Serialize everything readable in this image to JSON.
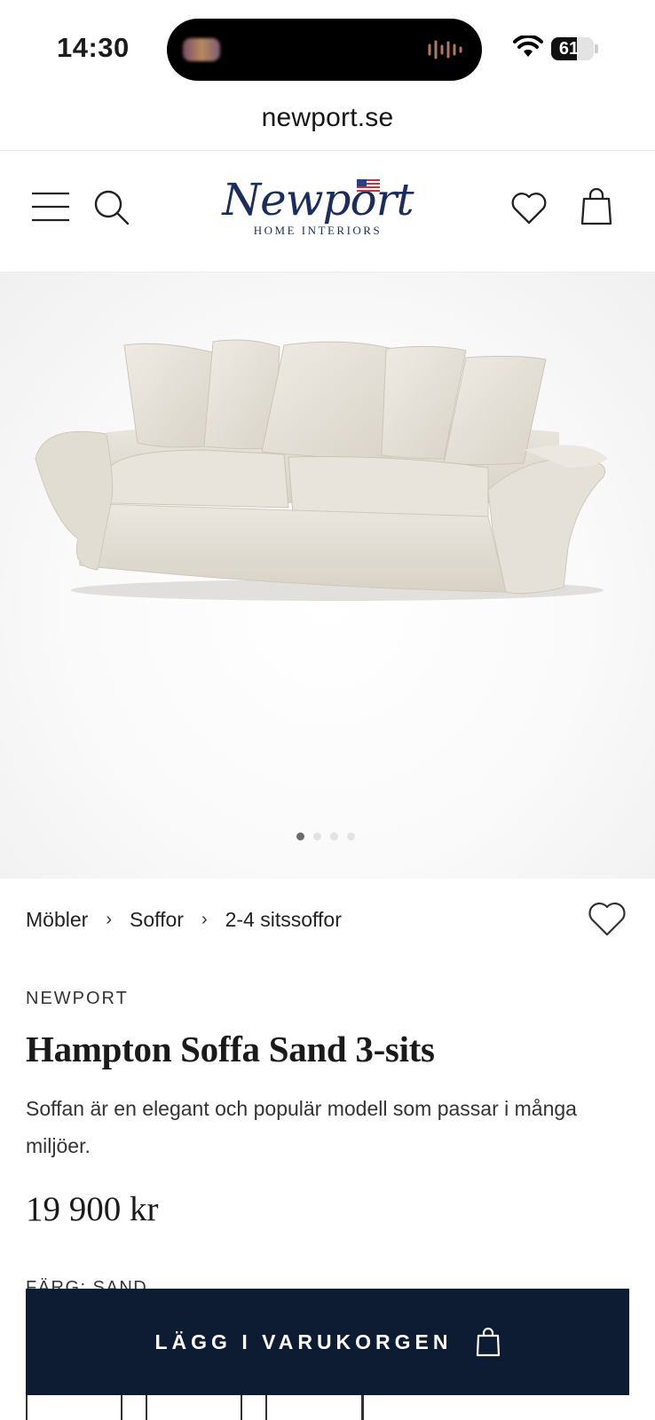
{
  "status_bar": {
    "time": "14:30",
    "battery": "61",
    "battery_level": 0.61
  },
  "browser": {
    "url": "newport.se"
  },
  "header": {
    "logo_word": "Newport",
    "logo_sub": "HOME INTERIORS",
    "icons": [
      "menu-icon",
      "search-icon",
      "wishlist-icon",
      "bag-icon"
    ]
  },
  "gallery": {
    "slides": 4,
    "active": 0
  },
  "breadcrumb": {
    "items": [
      "Möbler",
      "Soffor",
      "2-4 sitssoffor"
    ],
    "separator": "›"
  },
  "product": {
    "brand": "NEWPORT",
    "title": "Hampton Soffa Sand 3-sits",
    "description": "Soffan är en elegant och populär modell som passar i många miljöer.",
    "price": "19 900 kr",
    "color_label": "FÄRG: SAND"
  },
  "cta": {
    "label": "LÄGG I VARUKORGEN"
  },
  "colors": {
    "navy": "#0d1b33",
    "logo_blue": "#1b2d5c",
    "sofa": "#e2ddd3"
  }
}
